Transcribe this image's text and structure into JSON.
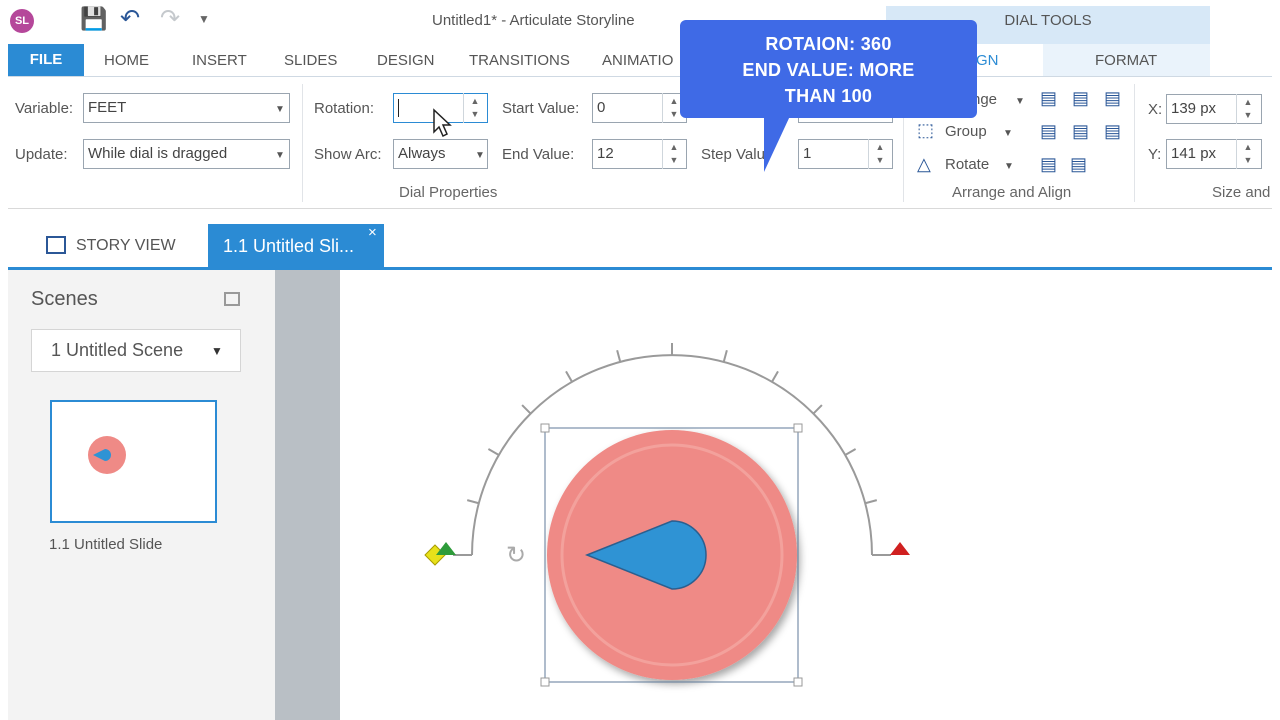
{
  "app": {
    "logo": "SL",
    "title": "Untitled1* -  Articulate Storyline",
    "tool_tab": "DIAL TOOLS"
  },
  "qat": {
    "save_icon": "save-icon",
    "undo_icon": "undo-icon",
    "redo_icon": "redo-icon",
    "customize_icon": "chevron-down-icon"
  },
  "tabs": [
    "FILE",
    "HOME",
    "INSERT",
    "SLIDES",
    "DESIGN",
    "TRANSITIONS",
    "ANIMATIO",
    "GN",
    "FORMAT"
  ],
  "ribbon": {
    "variable_label": "Variable:",
    "variable_value": "FEET",
    "update_label": "Update:",
    "update_value": "While dial is dragged",
    "rotation_label": "Rotation:",
    "rotation_value": "",
    "show_arc_label": "Show Arc:",
    "show_arc_value": "Always",
    "start_value_label": "Start Value:",
    "start_value": "0",
    "end_value_label": "End Value:",
    "end_value": "12",
    "step_value_label": "Step Valu",
    "step_value": "1",
    "dial_group": "Dial Properties",
    "arrange_label": "nge",
    "group_label": "Group",
    "rotate_label": "Rotate",
    "arrange_group": "Arrange and Align",
    "x_label": "X:",
    "x_value": "139 px",
    "y_label": "Y:",
    "y_value": "141 px",
    "size_group": "Size and"
  },
  "callout": {
    "line1": "ROTAION: 360",
    "line2": "END VALUE: MORE",
    "line3": "THAN 100"
  },
  "view": {
    "story_view": "STORY VIEW",
    "slide_tab": "1.1 Untitled Sli..."
  },
  "scenes": {
    "title": "Scenes",
    "selected": "1 Untitled Scene",
    "slide_label": "1.1 Untitled Slide"
  },
  "colors": {
    "accent": "#2b8bd4",
    "callout": "#3f6ae6",
    "dial": "#ef8a86",
    "pointer": "#2f93d4"
  }
}
